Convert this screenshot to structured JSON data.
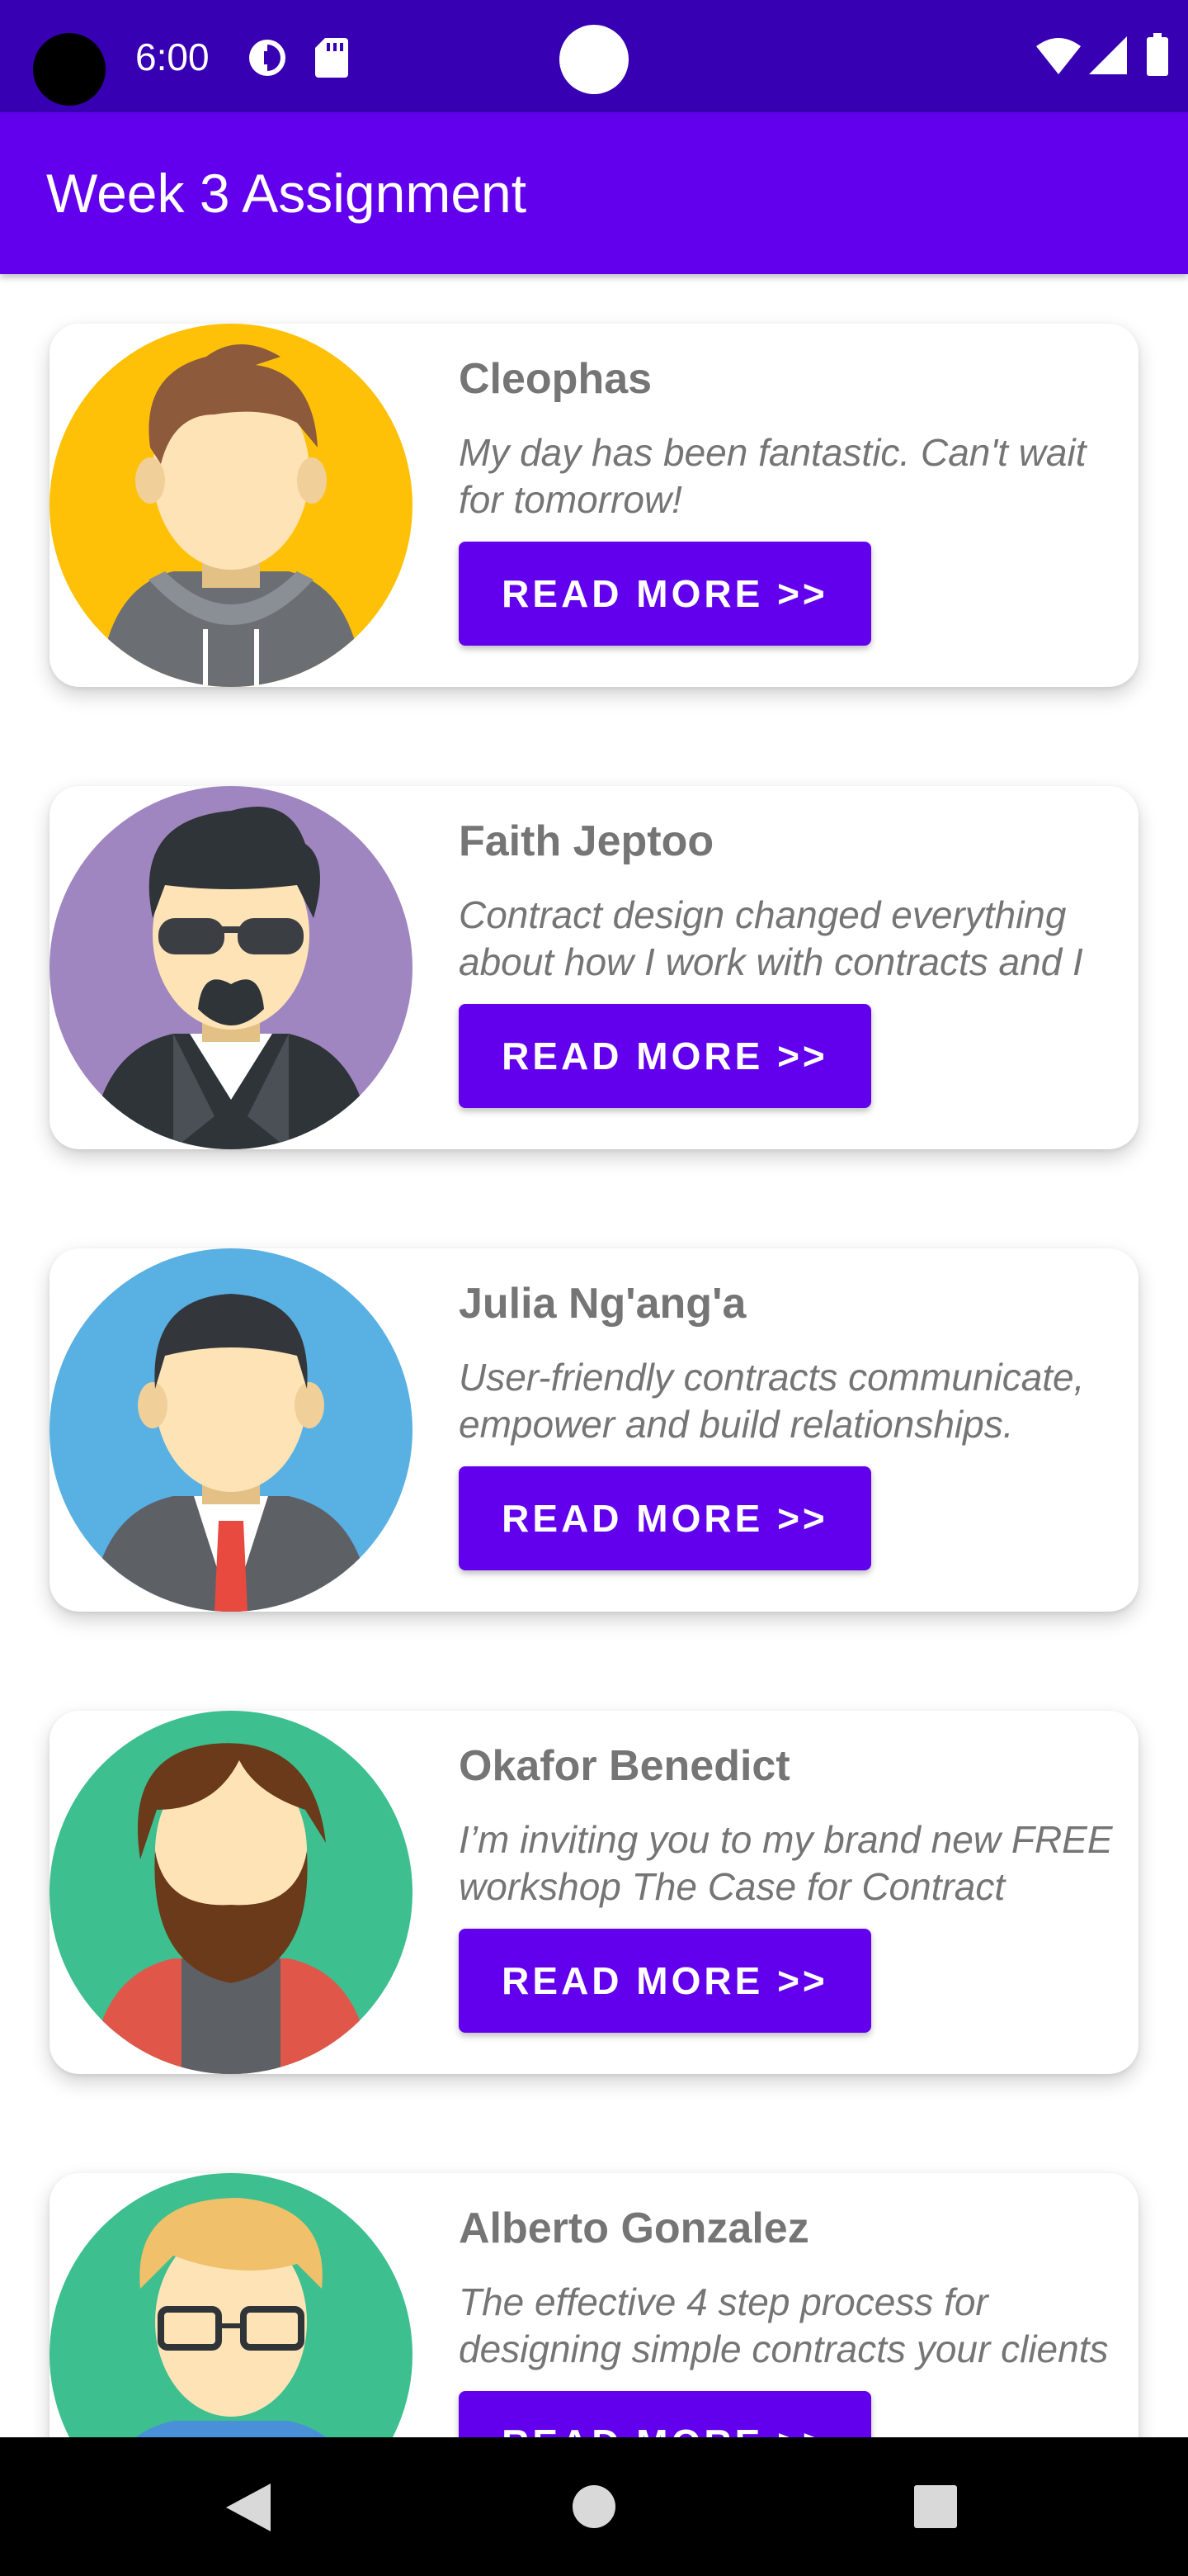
{
  "status_bar": {
    "time": "6:00",
    "icons": [
      "camera-cutout",
      "data-saver-icon",
      "sd-card-icon",
      "wifi-icon",
      "signal-icon",
      "battery-icon"
    ]
  },
  "app_bar": {
    "title": "Week 3 Assignment"
  },
  "theme": {
    "primary": "#6200ee",
    "primary_dark": "#3700b3",
    "text_gray": "#757575"
  },
  "profiles": [
    {
      "name": "Cleophas",
      "quote": "My day has been fantastic. Can't wait for tomorrow!",
      "button": "READ MORE >>",
      "avatar": "man-hoodie-avatar",
      "avatar_bg": "#ffc107"
    },
    {
      "name": "Faith Jeptoo",
      "quote": "Contract design changed everything about how I work with contracts and I can see how...",
      "button": "READ MORE >>",
      "avatar": "man-sunglasses-avatar",
      "avatar_bg": "#9f86c0"
    },
    {
      "name": "Julia Ng'ang'a",
      "quote": "User-friendly contracts communicate, empower and build relationships.",
      "button": "READ MORE >>",
      "avatar": "man-suit-avatar",
      "avatar_bg": "#59b0e3"
    },
    {
      "name": "Okafor Benedict",
      "quote": "I’m inviting you to my brand new FREE workshop The Case for Contract Design",
      "button": "READ MORE >>",
      "avatar": "man-beard-avatar",
      "avatar_bg": "#3dbf8f"
    },
    {
      "name": "Alberto Gonzalez",
      "quote": "The effective 4 step process for designing simple contracts your clients understand",
      "button": "READ MORE >>",
      "avatar": "man-glasses-avatar",
      "avatar_bg": "#3dbf8f"
    }
  ],
  "nav_bar": {
    "buttons": [
      "back-icon",
      "home-icon",
      "recents-icon"
    ]
  }
}
